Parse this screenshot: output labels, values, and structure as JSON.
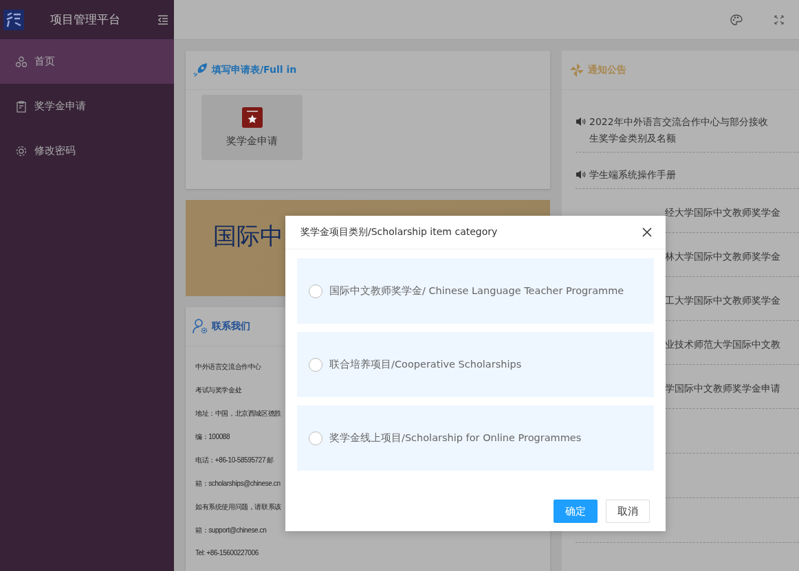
{
  "sidebar": {
    "title": "项目管理平台",
    "items": [
      {
        "label": "首页",
        "selected": true
      },
      {
        "label": "奖学金申请",
        "selected": false
      },
      {
        "label": "修改密码",
        "selected": false
      }
    ]
  },
  "apply_card": {
    "title": "填写申请表/Full in",
    "tiles": [
      {
        "label": "奖学金申请"
      }
    ]
  },
  "banner": {
    "text": "国际中"
  },
  "contact_card": {
    "title": "联系我们",
    "lines": [
      "中外语言交流合作中心",
      "考试与奖学金处",
      "地址：中国，北京西城区德胜",
      "编：100088",
      "电话：+86-10-58595727 邮",
      "箱：scholarships@chinese.cn",
      "如有系统使用问题，请联系该",
      "箱：support@chinese.cn",
      "Tel: +86-15600227006"
    ]
  },
  "notices": {
    "title": "通知公告",
    "items": [
      {
        "kind": "full",
        "lines": [
          "2022年中外语言交流合作中心与部分接收",
          "生奖学金类别及名额"
        ]
      },
      {
        "kind": "full",
        "lines": [
          "学生端系统操作手册"
        ]
      },
      {
        "kind": "covered",
        "lines": [
          "经大学国际中文教师奖学金"
        ]
      },
      {
        "kind": "covered",
        "lines": [
          "林大学国际中文教师奖学金"
        ]
      },
      {
        "kind": "covered",
        "lines": [
          "工大学国际中文教师奖学金"
        ]
      },
      {
        "kind": "covered",
        "lines": [
          "业技术师范大学国际中文教"
        ]
      },
      {
        "kind": "covered",
        "lines": [
          "学国际中文教师奖学金申请"
        ]
      }
    ]
  },
  "dialog": {
    "title": "奖学金项目类别/Scholarship item category",
    "options": [
      {
        "label": "国际中文教师奖学金/ Chinese Language Teacher Programme",
        "selected": false
      },
      {
        "label": "联合培养项目/Cooperative Scholarships",
        "selected": false
      },
      {
        "label": "奖学金线上项目/Scholarship for Online Programmes",
        "selected": false
      }
    ],
    "buttons": [
      {
        "label": "确定",
        "kind": "primary"
      },
      {
        "label": "取消",
        "kind": "secondary"
      }
    ]
  }
}
